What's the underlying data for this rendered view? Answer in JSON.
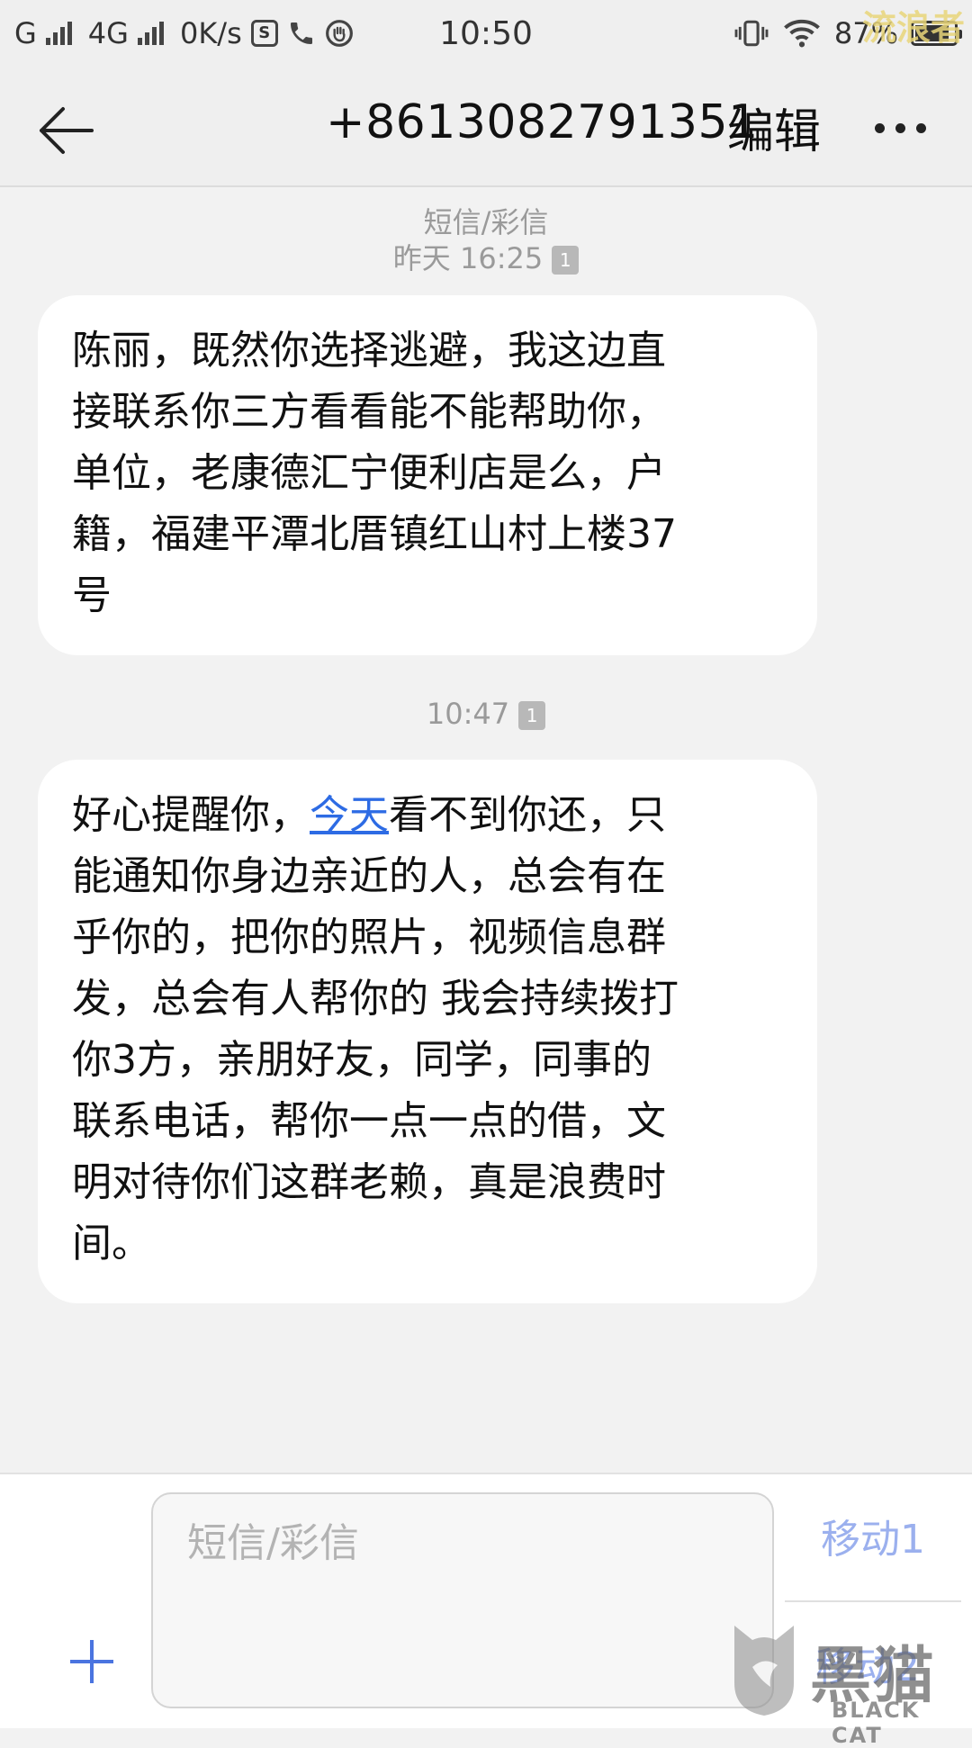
{
  "status_bar": {
    "carrier1": "G",
    "carrier2": "4G",
    "net_speed": "0K/s",
    "time": "10:50",
    "battery": "87%",
    "battery_level": 0.87
  },
  "header": {
    "title": "+8613082791351",
    "edit_label": "编辑"
  },
  "messages": [
    {
      "type_label": "短信/彩信",
      "time": "昨天 16:25",
      "sim": "1",
      "lines": [
        "陈丽，既然你选择逃避，我这边直",
        "接联系你三方看看能不能帮助你，",
        "单位，老康德汇宁便利店是么，户",
        "籍，福建平潭北厝镇红山村上楼37",
        "号"
      ]
    },
    {
      "time": "10:47",
      "sim": "1",
      "line1_before": "好心提醒你，",
      "line1_link": "今天",
      "line1_after": "看不到你还，只",
      "lines": [
        "能通知你身边亲近的人，总会有在",
        "乎你的，把你的照片，视频信息群",
        "发，总会有人帮你的 我会持续拨打",
        "你3方，亲朋好友，同学，同事的",
        "联系电话，帮你一点一点的借，文",
        "明对待你们这群老赖，真是浪费时",
        "间。"
      ]
    }
  ],
  "composer": {
    "placeholder": "短信/彩信",
    "send_sim1": "移动1",
    "send_sim2": "移动2"
  },
  "watermarks": {
    "top_right": "流浪者",
    "brand_cn": "黑猫",
    "brand_en": "BLACK CAT"
  }
}
